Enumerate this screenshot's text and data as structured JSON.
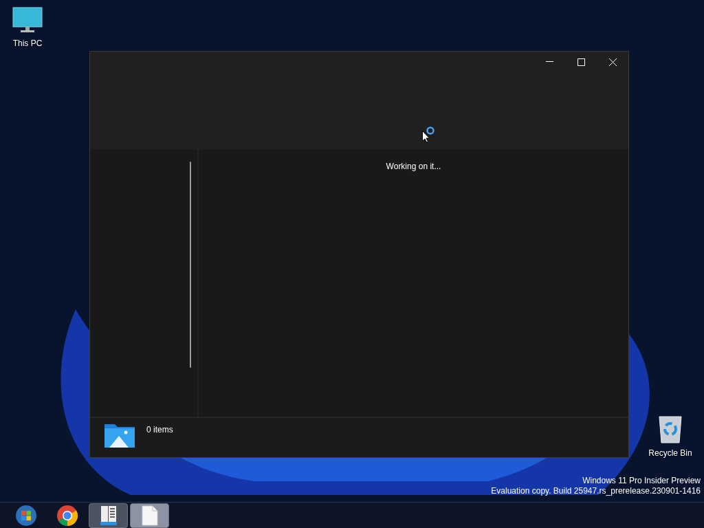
{
  "desktop": {
    "icons": [
      {
        "kind": "computer",
        "label": "This PC"
      },
      {
        "kind": "recycle",
        "label": "Recycle Bin"
      }
    ],
    "evaluation_notice": [
      "Windows 11 Pro Insider Preview",
      "Evaluation copy. Build 25947.rs_prerelease.230901-1416"
    ]
  },
  "window": {
    "status": "Working on it...",
    "item_count": "0 items"
  },
  "taskbar": {
    "items": [
      {
        "kind": "start",
        "selected": false
      },
      {
        "kind": "browser",
        "selected": false
      },
      {
        "kind": "explorer",
        "selected": false
      },
      {
        "kind": "document",
        "selected": true
      }
    ]
  }
}
